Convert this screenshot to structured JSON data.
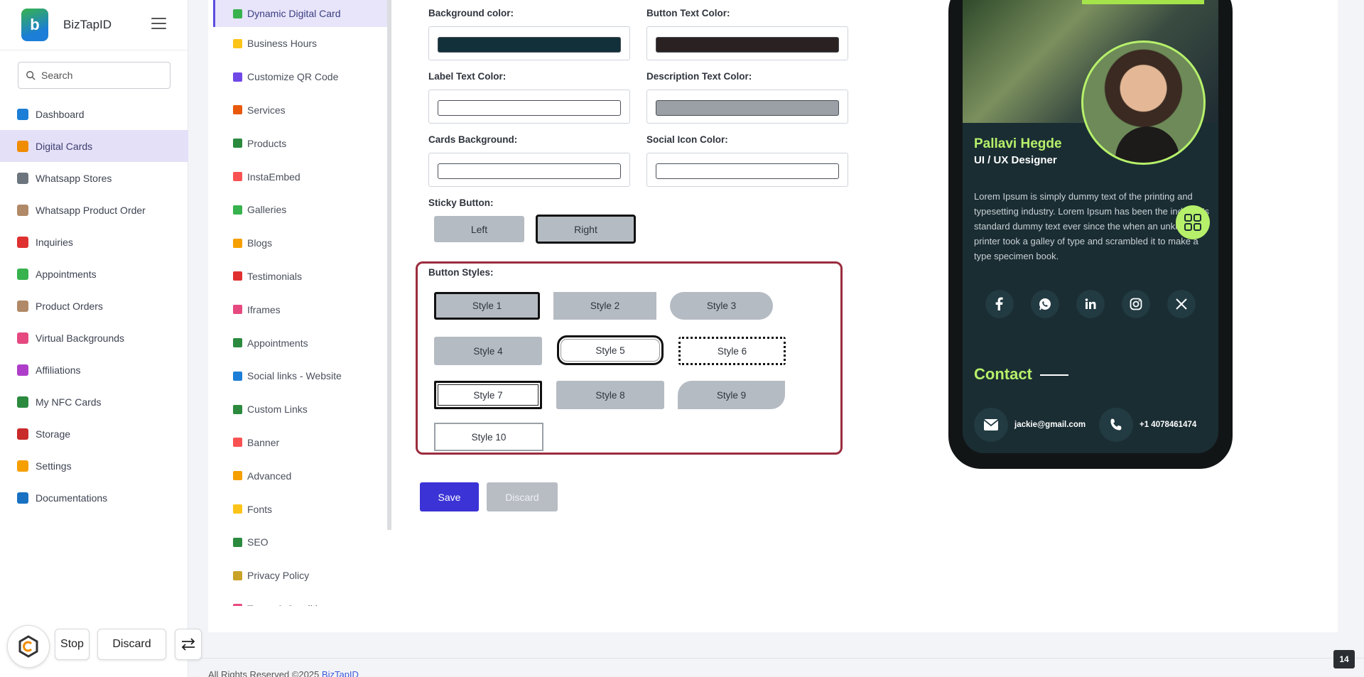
{
  "brand": {
    "name": "BizTapID"
  },
  "search": {
    "placeholder": "Search"
  },
  "sidebar": {
    "items": [
      {
        "label": "Dashboard",
        "icon": "pie-chart-icon",
        "color": "#1c7ed6"
      },
      {
        "label": "Digital Cards",
        "icon": "id-card-icon",
        "color": "#f08c00",
        "active": true
      },
      {
        "label": "Whatsapp Stores",
        "icon": "whatsapp-icon",
        "color": "#6c757d"
      },
      {
        "label": "Whatsapp Product Order",
        "icon": "cart-icon",
        "color": "#b08968"
      },
      {
        "label": "Inquiries",
        "icon": "info-icon",
        "color": "#e03131"
      },
      {
        "label": "Appointments",
        "icon": "calendar-icon",
        "color": "#37b24d"
      },
      {
        "label": "Product Orders",
        "icon": "box-icon",
        "color": "#b08968"
      },
      {
        "label": "Virtual Backgrounds",
        "icon": "image-icon",
        "color": "#e64980"
      },
      {
        "label": "Affiliations",
        "icon": "layers-icon",
        "color": "#ae3ec9"
      },
      {
        "label": "My NFC Cards",
        "icon": "nfc-card-icon",
        "color": "#2b8a3e"
      },
      {
        "label": "Storage",
        "icon": "storage-icon",
        "color": "#c92a2a"
      },
      {
        "label": "Settings",
        "icon": "gear-icon",
        "color": "#f59f00"
      },
      {
        "label": "Documentations",
        "icon": "book-icon",
        "color": "#1971c2"
      }
    ]
  },
  "submenu": {
    "items": [
      {
        "label": "Dynamic Digital Card",
        "icon": "card-icon",
        "color": "#37b24d",
        "active": true
      },
      {
        "label": "Business Hours",
        "icon": "clock-icon",
        "color": "#fcc419"
      },
      {
        "label": "Customize QR Code",
        "icon": "qr-code-icon",
        "color": "#7048e8"
      },
      {
        "label": "Services",
        "icon": "wrench-icon",
        "color": "#e8590c"
      },
      {
        "label": "Products",
        "icon": "product-icon",
        "color": "#2b8a3e"
      },
      {
        "label": "InstaEmbed",
        "icon": "embed-icon",
        "color": "#fa5252"
      },
      {
        "label": "Galleries",
        "icon": "gallery-icon",
        "color": "#37b24d"
      },
      {
        "label": "Blogs",
        "icon": "blog-icon",
        "color": "#f59f00"
      },
      {
        "label": "Testimonials",
        "icon": "chat-icon",
        "color": "#e03131"
      },
      {
        "label": "Iframes",
        "icon": "iframe-icon",
        "color": "#e64980"
      },
      {
        "label": "Appointments",
        "icon": "calendar-check-icon",
        "color": "#2b8a3e"
      },
      {
        "label": "Social links - Website",
        "icon": "globe-icon",
        "color": "#1c7ed6"
      },
      {
        "label": "Custom Links",
        "icon": "link-icon",
        "color": "#2b8a3e"
      },
      {
        "label": "Banner",
        "icon": "banner-icon",
        "color": "#fa5252"
      },
      {
        "label": "Advanced",
        "icon": "gears-icon",
        "color": "#f59f00"
      },
      {
        "label": "Fonts",
        "icon": "font-icon",
        "color": "#fcc419"
      },
      {
        "label": "SEO",
        "icon": "magnifier-icon",
        "color": "#2b8a3e"
      },
      {
        "label": "Privacy Policy",
        "icon": "lock-icon",
        "color": "#c9a227"
      },
      {
        "label": "Terms & Conditions",
        "icon": "terms-icon",
        "color": "#e64980"
      }
    ]
  },
  "form": {
    "background_color": {
      "label": "Background color:",
      "value": "#11303a"
    },
    "button_text_color": {
      "label": "Button Text Color:",
      "value": "#2a2222"
    },
    "label_text_color": {
      "label": "Label Text Color:",
      "value": "#ffffff"
    },
    "description_text_color": {
      "label": "Description Text Color:",
      "value": "#9aa0a6"
    },
    "cards_background": {
      "label": "Cards Background:",
      "value": "#ffffff"
    },
    "social_icon_color": {
      "label": "Social Icon Color:",
      "value": "#ffffff"
    },
    "sticky_button": {
      "label": "Sticky Button:",
      "left": "Left",
      "right": "Right",
      "selected": "Right"
    },
    "button_styles": {
      "label": "Button Styles:",
      "selected": "Style 1",
      "styles": [
        "Style 1",
        "Style 2",
        "Style 3",
        "Style 4",
        "Style 5",
        "Style 6",
        "Style 7",
        "Style 8",
        "Style 9",
        "Style 10"
      ]
    },
    "save_label": "Save",
    "discard_label": "Discard"
  },
  "preview": {
    "name": "Pallavi Hegde",
    "role": "UI / UX Designer",
    "description": "Lorem Ipsum is simply dummy text of the printing and typesetting industry. Lorem Ipsum has been the industry's standard dummy text ever since the when an unknown printer took a galley of type and scrambled it to make a type specimen book.",
    "socials": [
      "facebook-icon",
      "whatsapp-icon",
      "linkedin-icon",
      "instagram-icon",
      "x-icon"
    ],
    "contact_title": "Contact",
    "email": "jackie@gmail.com",
    "phone": "+1 4078461474",
    "accent": "#b6f06a"
  },
  "footer": {
    "text": "All Rights Reserved ©2025",
    "link": "BizTapID"
  },
  "overlay": {
    "stop": "Stop",
    "discard": "Discard",
    "page_number": "14"
  }
}
